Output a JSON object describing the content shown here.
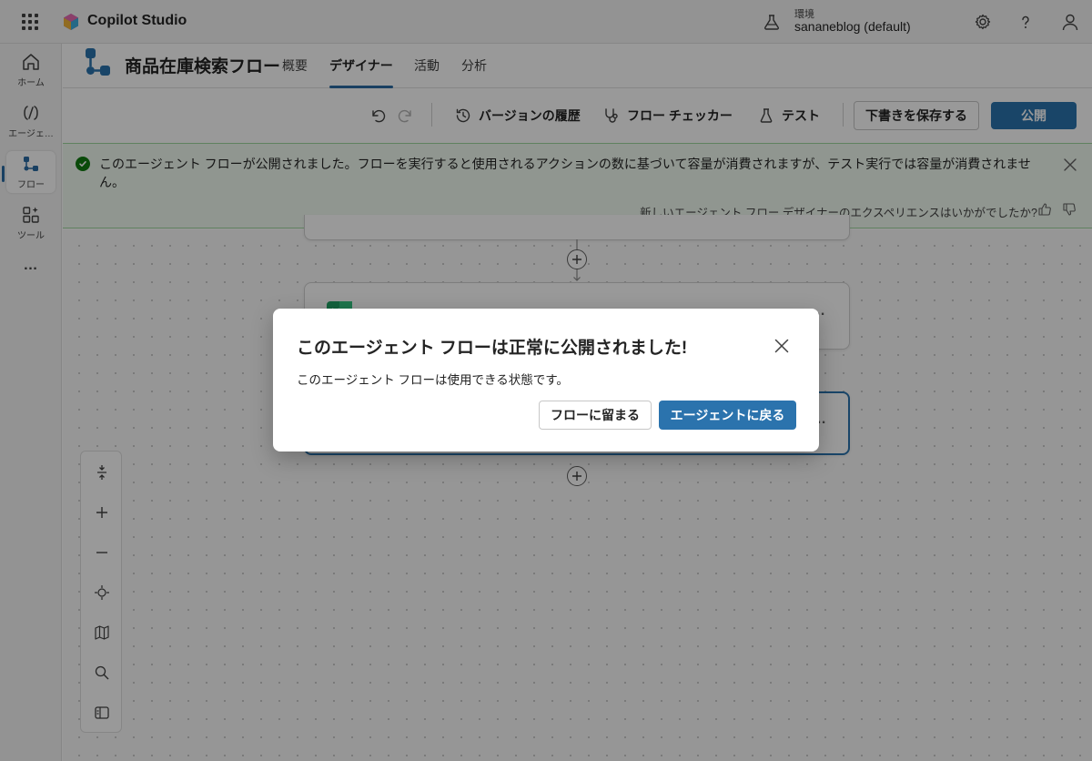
{
  "app": {
    "title": "Copilot Studio"
  },
  "environment": {
    "label": "環境",
    "value": "sananeblog (default)"
  },
  "top_icons": [
    "settings-icon",
    "help-icon",
    "user-icon"
  ],
  "rail": {
    "items": [
      {
        "label": "ホーム",
        "icon": "home-icon"
      },
      {
        "label": "エージェ…",
        "icon": "agents-icon"
      },
      {
        "label": "フロー",
        "icon": "flow-icon",
        "active": true
      },
      {
        "label": "ツール",
        "icon": "tools-icon"
      }
    ],
    "more": "…"
  },
  "header": {
    "flow_title": "商品在庫検索フロー",
    "tabs": [
      {
        "label": "概要"
      },
      {
        "label": "デザイナー",
        "active": true
      },
      {
        "label": "活動"
      },
      {
        "label": "分析"
      }
    ]
  },
  "toolbar": {
    "version_history": "バージョンの履歴",
    "flow_checker": "フロー チェッカー",
    "test": "テスト",
    "save_draft": "下書きを保存する",
    "publish": "公開"
  },
  "banner": {
    "message": "このエージェント フローが公開されました。フローを実行すると使用されるアクションの数に基づいて容量が消費されますが、テスト実行では容量が消費されません。",
    "feedback": "新しいエージェント フロー デザイナーのエクスペリエンスはいかがでしたか?"
  },
  "canvas": {
    "node_menu": "…"
  },
  "dialog": {
    "title": "このエージェント フローは正常に公開されました!",
    "body": "このエージェント フローは使用できる状態です。",
    "stay_button": "フローに留まる",
    "return_button": "エージェントに戻る"
  },
  "colors": {
    "accent": "#2b73ad",
    "success": "#107c10",
    "banner_bg": "#f1faf1"
  }
}
